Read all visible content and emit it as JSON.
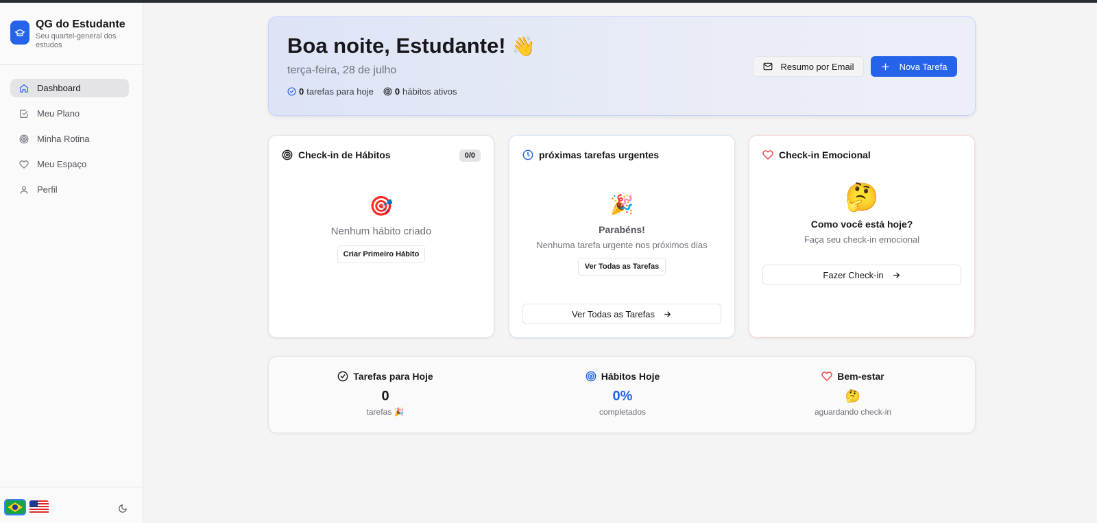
{
  "app": {
    "title": "QG do Estudante",
    "subtitle": "Seu quartel-general dos estudos"
  },
  "sidebar": {
    "items": [
      {
        "label": "Dashboard",
        "icon": "home-icon",
        "active": true
      },
      {
        "label": "Meu Plano",
        "icon": "checkbox-icon",
        "active": false
      },
      {
        "label": "Minha Rotina",
        "icon": "target-icon",
        "active": false
      },
      {
        "label": "Meu Espaço",
        "icon": "heart-icon",
        "active": false
      },
      {
        "label": "Perfil",
        "icon": "user-icon",
        "active": false
      }
    ],
    "languages": [
      "pt-BR flag",
      "en-US flag"
    ],
    "theme_toggle_icon": "moon-icon"
  },
  "hero": {
    "greeting": "Boa noite, Estudante!",
    "greeting_emoji": "👋",
    "date": "terça-feira, 28 de julho",
    "tasks_count": "0",
    "tasks_label": "tarefas para hoje",
    "habits_count": "0",
    "habits_label": "hábitos ativos",
    "email_button": "Resumo por Email",
    "new_task_button": "Nova Tarefa"
  },
  "habits_card": {
    "title": "Check-in de Hábitos",
    "badge": "0/0",
    "emoji": "🎯",
    "empty_text": "Nenhum hábito criado",
    "button": "Criar Primeiro Hábito"
  },
  "tasks_card": {
    "title": "próximas tarefas urgentes",
    "emoji": "🎉",
    "heading": "Parabéns!",
    "text": "Nenhuma tarefa urgente nos próximos dias",
    "button_small": "Ver Todas as Tarefas",
    "button_wide": "Ver Todas as Tarefas"
  },
  "emotional_card": {
    "title": "Check-in Emocional",
    "emoji": "🤔",
    "heading": "Como você está hoje?",
    "text": "Faça seu check-in emocional",
    "button": "Fazer Check-in"
  },
  "summary": {
    "tasks": {
      "title": "Tarefas para Hoje",
      "value": "0",
      "sub": "tarefas 🎉"
    },
    "habits": {
      "title": "Hábitos Hoje",
      "value": "0%",
      "sub": "completados"
    },
    "wellbeing": {
      "title": "Bem-estar",
      "value": "🤔",
      "sub": "aguardando check-in"
    }
  },
  "colors": {
    "accent": "#2563eb",
    "heart": "#ef4444",
    "background": "#f4f4f5"
  }
}
